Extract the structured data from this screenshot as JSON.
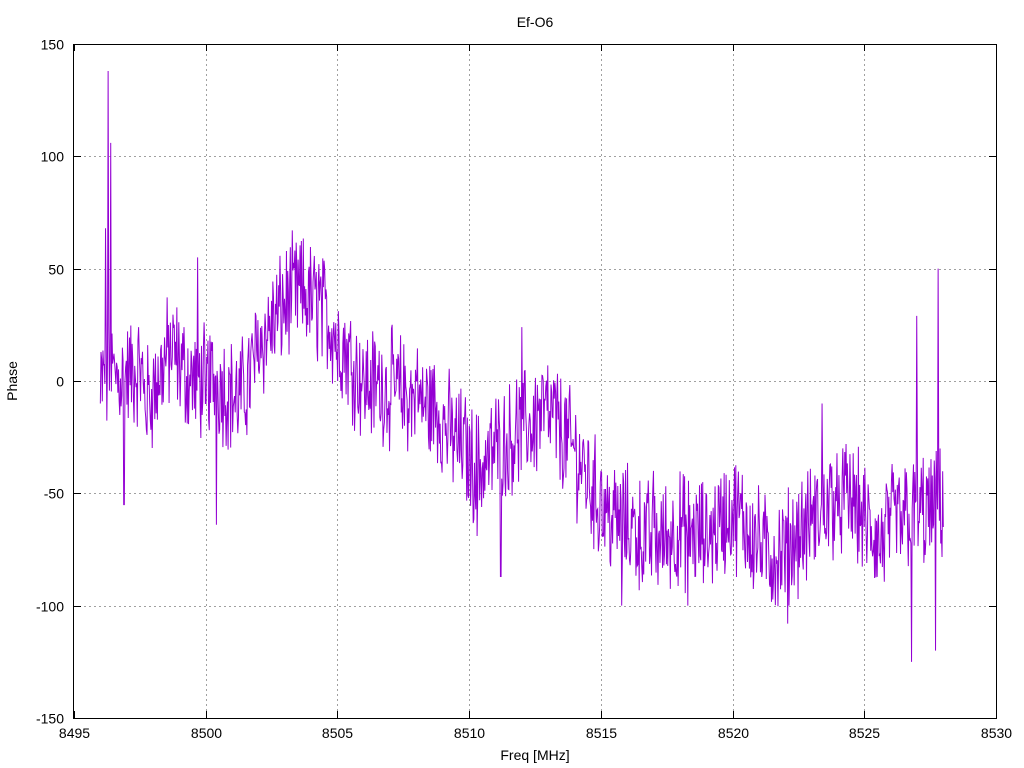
{
  "chart_data": {
    "type": "line",
    "title": "Ef-O6",
    "xlabel": "Freq [MHz]",
    "ylabel": "Phase",
    "xlim": [
      8495,
      8530
    ],
    "ylim": [
      -150,
      150
    ],
    "xticks": [
      8495,
      8500,
      8505,
      8510,
      8515,
      8520,
      8525,
      8530
    ],
    "yticks": [
      -150,
      -100,
      -50,
      0,
      50,
      100,
      150
    ],
    "xtick_labels": [
      "8495",
      "8500",
      "8505",
      "8510",
      "8515",
      "8520",
      "8525",
      "8530"
    ],
    "ytick_labels": [
      "-150",
      "-100",
      "-50",
      "0",
      "50",
      "100",
      "150"
    ],
    "grid": true,
    "legend": "none",
    "series": [
      {
        "color": "#9400d3",
        "x_range": [
          8496.0,
          8528.0
        ],
        "envelope": [
          {
            "x": 8496.0,
            "y": -10
          },
          {
            "x": 8496.2,
            "y": 68
          },
          {
            "x": 8496.3,
            "y": 138
          },
          {
            "x": 8496.4,
            "y": 106
          },
          {
            "x": 8496.5,
            "y": 10
          },
          {
            "x": 8496.9,
            "y": -55
          },
          {
            "x": 8497.5,
            "y": 5
          },
          {
            "x": 8498.0,
            "y": -5
          },
          {
            "x": 8499.0,
            "y": 10
          },
          {
            "x": 8499.7,
            "y": 55
          },
          {
            "x": 8500.0,
            "y": -10
          },
          {
            "x": 8500.4,
            "y": -64
          },
          {
            "x": 8501.0,
            "y": 5
          },
          {
            "x": 8502.0,
            "y": 5
          },
          {
            "x": 8503.5,
            "y": 54
          },
          {
            "x": 8504.3,
            "y": 52
          },
          {
            "x": 8505.0,
            "y": 0
          },
          {
            "x": 8506.0,
            "y": 5
          },
          {
            "x": 8507.0,
            "y": -10
          },
          {
            "x": 8508.0,
            "y": 0
          },
          {
            "x": 8509.0,
            "y": -20
          },
          {
            "x": 8510.0,
            "y": -20
          },
          {
            "x": 8510.3,
            "y": -69
          },
          {
            "x": 8511.0,
            "y": -20
          },
          {
            "x": 8511.2,
            "y": -87
          },
          {
            "x": 8512.0,
            "y": 24
          },
          {
            "x": 8513.0,
            "y": -25
          },
          {
            "x": 8514.0,
            "y": -30
          },
          {
            "x": 8515.0,
            "y": -40
          },
          {
            "x": 8515.8,
            "y": -100
          },
          {
            "x": 8517.0,
            "y": -40
          },
          {
            "x": 8518.3,
            "y": -100
          },
          {
            "x": 8519.0,
            "y": -50
          },
          {
            "x": 8520.0,
            "y": -60
          },
          {
            "x": 8521.0,
            "y": -60
          },
          {
            "x": 8522.1,
            "y": -108
          },
          {
            "x": 8523.0,
            "y": -55
          },
          {
            "x": 8523.4,
            "y": -10
          },
          {
            "x": 8524.0,
            "y": -60
          },
          {
            "x": 8525.0,
            "y": -65
          },
          {
            "x": 8526.0,
            "y": -60
          },
          {
            "x": 8526.8,
            "y": -125
          },
          {
            "x": 8527.0,
            "y": 29
          },
          {
            "x": 8527.5,
            "y": -60
          },
          {
            "x": 8527.7,
            "y": -120
          },
          {
            "x": 8527.8,
            "y": 50
          },
          {
            "x": 8528.0,
            "y": -65
          }
        ]
      }
    ]
  }
}
